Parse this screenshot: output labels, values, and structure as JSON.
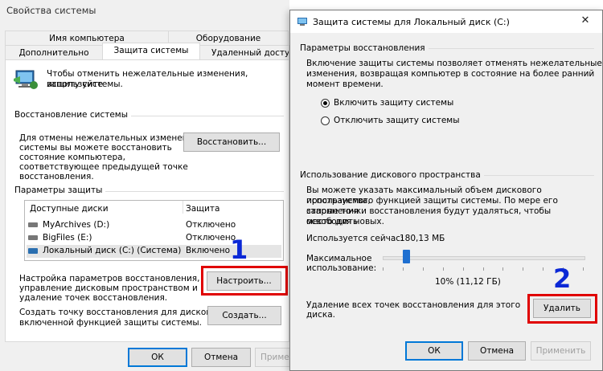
{
  "back_window": {
    "title": "Свойства системы",
    "tabs_row1": [
      "Имя компьютера",
      "Оборудование"
    ],
    "tabs_row2": [
      "Дополнительно",
      "Защита системы",
      "Удаленный доступ"
    ],
    "intro_text_1": "Чтобы отменить нежелательные изменения, используйте",
    "intro_text_2": "защиту системы.",
    "restore_group": "Восстановление системы",
    "restore_desc": [
      "Для отмены нежелательных изменений",
      "системы вы можете восстановить",
      "состояние компьютера,",
      "соответствующее предыдущей точке",
      "восстановления."
    ],
    "restore_button": "Восстановить...",
    "protection_group": "Параметры защиты",
    "table_headers": [
      "Доступные диски",
      "Защита"
    ],
    "drives": [
      {
        "name": "MyArchives (D:)",
        "status": "Отключено"
      },
      {
        "name": "BigFiles (E:)",
        "status": "Отключено"
      },
      {
        "name": "Локальный диск (C:) (Система)",
        "status": "Включено"
      }
    ],
    "configure_desc": [
      "Настройка параметров восстановления,",
      "управление дисковым пространством и",
      "удаление точек восстановления."
    ],
    "configure_button": "Настроить...",
    "create_desc": [
      "Создать точку восстановления для дисков с",
      "включенной функцией защиты системы."
    ],
    "create_button": "Создать...",
    "ok": "ОК",
    "cancel": "Отмена",
    "apply": "Примен"
  },
  "front_window": {
    "title": "Защита системы для Локальный диск (C:)",
    "close_glyph": "✕",
    "restore_params_group": "Параметры восстановления",
    "restore_params_desc": [
      "Включение защиты системы позволяет отменять нежелательные",
      "изменения, возвращая компьютер в состояние на более ранний",
      "момент времени."
    ],
    "radio_on": "Включить защиту системы",
    "radio_off": "Отключить защиту системы",
    "disk_usage_group": "Использование дискового пространства",
    "disk_usage_desc": [
      "Вы можете указать максимальный объем дискового пространства,",
      "используемого функцией защиты системы. По мере его заполнения",
      "старые точки восстановления будут удаляться, чтобы освободить",
      "место для новых."
    ],
    "current_usage_label": "Используется сейчас:",
    "current_usage_value": "180,13 МБ",
    "max_usage_label_1": "Максимальное",
    "max_usage_label_2": "использование:",
    "slider_fraction": 0.1,
    "slider_value": "10% (11,12 ГБ)",
    "delete_desc": [
      "Удаление всех точек восстановления для этого",
      "диска."
    ],
    "delete_button": "Удалить",
    "ok": "ОК",
    "cancel": "Отмена",
    "apply": "Применить"
  },
  "annotations": {
    "marker_1": "1",
    "marker_2": "2",
    "highlight_color": "#e00000",
    "number_color": "#0b28d6"
  }
}
